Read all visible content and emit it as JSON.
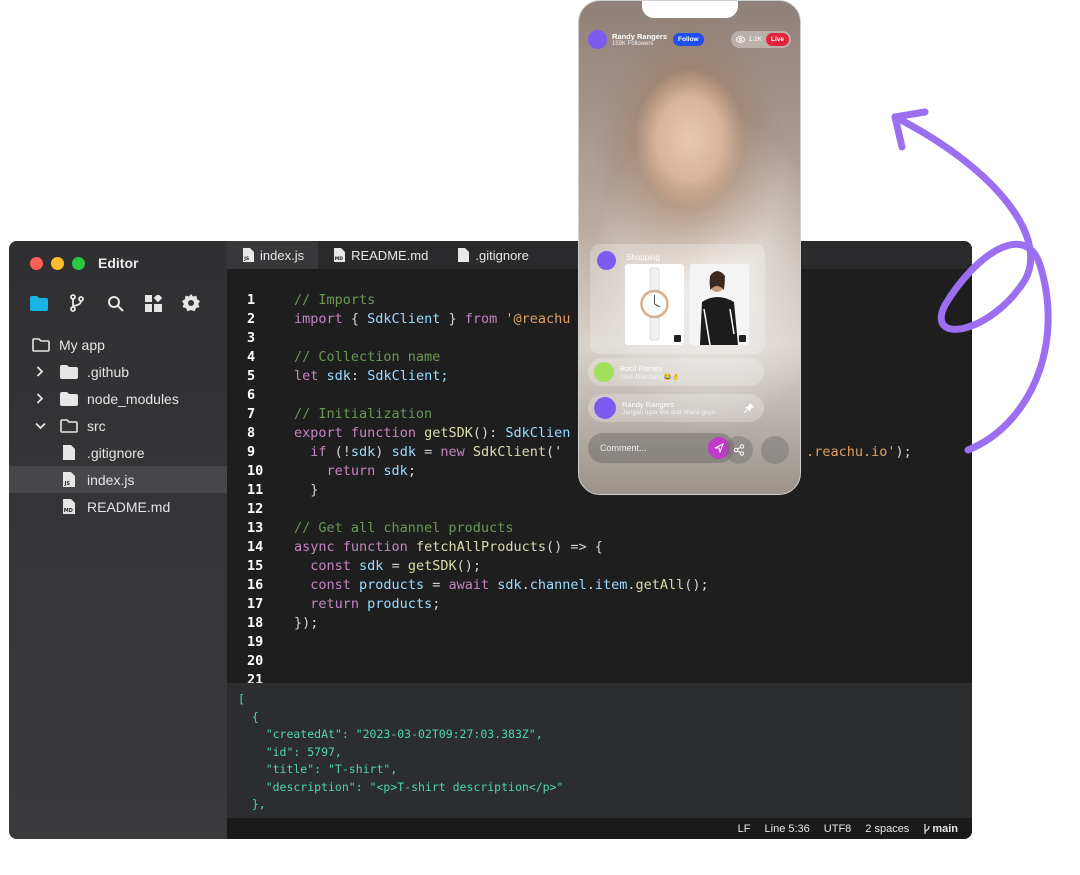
{
  "window": {
    "title": "Editor"
  },
  "sidebar": {
    "tools": [
      "folder-icon",
      "git-branch-icon",
      "search-icon",
      "extensions-icon",
      "gear-icon"
    ],
    "tree": [
      {
        "label": "My app",
        "type": "folder-open",
        "depth": 0
      },
      {
        "label": ".github",
        "type": "folder",
        "depth": 1
      },
      {
        "label": "node_modules",
        "type": "folder",
        "depth": 1
      },
      {
        "label": "src",
        "type": "folder-open",
        "depth": 1
      },
      {
        "label": ".gitignore",
        "type": "file",
        "depth": 1
      },
      {
        "label": "index.js",
        "type": "file-js",
        "depth": 1,
        "selected": true
      },
      {
        "label": "README.md",
        "type": "file-md",
        "depth": 1
      }
    ]
  },
  "tabs": [
    {
      "label": "index.js",
      "icon": "js-file-icon",
      "active": true
    },
    {
      "label": "README.md",
      "icon": "md-file-icon",
      "active": false
    },
    {
      "label": ".gitignore",
      "icon": "file-icon",
      "active": false
    }
  ],
  "code": {
    "line_numbers": [
      "1",
      "2",
      "3",
      "4",
      "5",
      "6",
      "7",
      "8",
      "9",
      "10",
      "11",
      "12",
      "13",
      "14",
      "15",
      "16",
      "17",
      "18",
      "19",
      "20",
      "21"
    ],
    "lines": [
      [
        [
          "// Imports",
          "cm"
        ]
      ],
      [
        [
          "import",
          "kw"
        ],
        [
          " { ",
          "pl"
        ],
        [
          "SdkClient",
          "id"
        ],
        [
          " } ",
          "pl"
        ],
        [
          "from",
          "kw"
        ],
        [
          " '@reachu",
          "str2"
        ]
      ],
      [],
      [
        [
          "// Collection name",
          "cm"
        ]
      ],
      [
        [
          "let",
          "kw"
        ],
        [
          " ",
          "pl"
        ],
        [
          "sdk",
          "id"
        ],
        [
          ": ",
          "pl"
        ],
        [
          "SdkClient;",
          "id"
        ]
      ],
      [],
      [
        [
          "// Initialization",
          "cm"
        ]
      ],
      [
        [
          "export",
          "kw"
        ],
        [
          " ",
          "pl"
        ],
        [
          "function",
          "kw"
        ],
        [
          " ",
          "pl"
        ],
        [
          "getSDK",
          "fn"
        ],
        [
          "(): ",
          "pl"
        ],
        [
          "SdkClien",
          "id"
        ]
      ],
      [
        [
          "  if",
          "kw"
        ],
        [
          " (!",
          "pl"
        ],
        [
          "sdk",
          "id"
        ],
        [
          ") ",
          "pl"
        ],
        [
          "sdk",
          "id"
        ],
        [
          " = ",
          "pl"
        ],
        [
          "new",
          "kw"
        ],
        [
          " ",
          "pl"
        ],
        [
          "SdkClient",
          "fn"
        ],
        [
          "('",
          "pl"
        ],
        [
          "                              .reachu.io'",
          "str2"
        ],
        [
          ");",
          "pl"
        ]
      ],
      [
        [
          "    return",
          "kw"
        ],
        [
          " ",
          "pl"
        ],
        [
          "sdk",
          "id"
        ],
        [
          ";",
          "pl"
        ]
      ],
      [
        [
          "  }",
          "pl"
        ]
      ],
      [],
      [
        [
          "// Get all channel products",
          "cm"
        ]
      ],
      [
        [
          "async",
          "kw"
        ],
        [
          " ",
          "pl"
        ],
        [
          "function",
          "kw"
        ],
        [
          " ",
          "pl"
        ],
        [
          "fetchAllProducts",
          "fn"
        ],
        [
          "() => {",
          "pl"
        ]
      ],
      [
        [
          "  const",
          "kw"
        ],
        [
          " ",
          "pl"
        ],
        [
          "sdk",
          "id"
        ],
        [
          " = ",
          "pl"
        ],
        [
          "getSDK",
          "fn"
        ],
        [
          "();",
          "pl"
        ]
      ],
      [
        [
          "  const",
          "kw"
        ],
        [
          " ",
          "pl"
        ],
        [
          "products",
          "id"
        ],
        [
          " = ",
          "pl"
        ],
        [
          "await",
          "kw"
        ],
        [
          " ",
          "pl"
        ],
        [
          "sdk",
          "id"
        ],
        [
          ".",
          "pl"
        ],
        [
          "channel",
          "id"
        ],
        [
          ".",
          "pl"
        ],
        [
          "item",
          "id"
        ],
        [
          ".",
          "pl"
        ],
        [
          "getAll",
          "fn"
        ],
        [
          "();",
          "pl"
        ]
      ],
      [
        [
          "  return",
          "kw"
        ],
        [
          " ",
          "pl"
        ],
        [
          "products",
          "id"
        ],
        [
          ";",
          "pl"
        ]
      ],
      [
        [
          "});",
          "pl"
        ]
      ],
      [],
      [],
      []
    ]
  },
  "output": {
    "lines": [
      "[",
      "  {",
      "    \"createdAt\": \"2023-03-02T09:27:03.383Z\",",
      "    \"id\": 5797,",
      "    \"title\": \"T-shirt\",",
      "    \"description\": \"<p>T-shirt description</p>\"",
      "  },"
    ]
  },
  "status": {
    "eol": "LF",
    "position": "Line 5:36",
    "encoding": "UTF8",
    "indent": "2 spaces",
    "branch": "main"
  },
  "phone": {
    "host_name": "Randy Rangers",
    "followers": "159K Followers",
    "follow_label": "Follow",
    "viewers": "1.2K",
    "live_label": "Live",
    "shopping_label": "Shopping",
    "chats": [
      {
        "name": "Bocil Rames",
        "message": "Give Alok bang😂👌",
        "avatar_color": "#a3e05a"
      },
      {
        "name": "Randy Rangers",
        "message": "Jangan lupa like and share guys",
        "avatar_color": "#7c5cf0"
      }
    ],
    "comment_placeholder": "Comment..."
  },
  "colors": {
    "accent_purple": "#9b6ff0",
    "follow_blue": "#1f4ff0",
    "live_red": "#e0243b",
    "send_magenta": "#c13ac8",
    "traffic_red": "#fe5f57",
    "traffic_yellow": "#febc2e",
    "traffic_green": "#28c840"
  }
}
